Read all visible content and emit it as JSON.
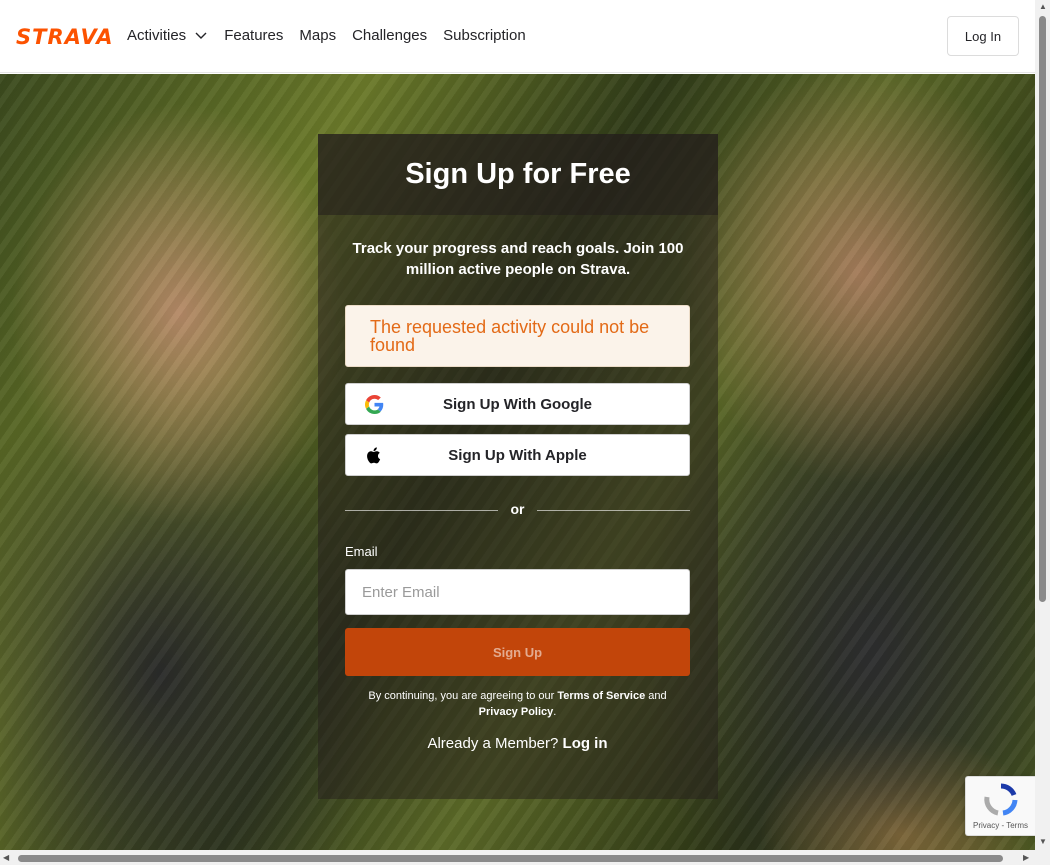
{
  "header": {
    "logo": "STRAVA",
    "nav": [
      {
        "label": "Activities",
        "has_dropdown": true
      },
      {
        "label": "Features"
      },
      {
        "label": "Maps"
      },
      {
        "label": "Challenges"
      },
      {
        "label": "Subscription"
      }
    ],
    "login_label": "Log In"
  },
  "card": {
    "title": "Sign Up for Free",
    "tagline": "Track your progress and reach goals. Join 100 million active people on Strava.",
    "alert": "The requested activity could not be found",
    "google_label": "Sign Up With Google",
    "apple_label": "Sign Up With Apple",
    "divider": "or",
    "email_label": "Email",
    "email_placeholder": "Enter Email",
    "email_value": "",
    "signup_label": "Sign Up",
    "legal_prefix": "By continuing, you are agreeing to our ",
    "terms_link": "Terms of Service",
    "legal_and": " and ",
    "privacy_link": "Privacy Policy",
    "legal_suffix": ".",
    "member_prefix": "Already a Member? ",
    "member_link": "Log in"
  },
  "recaptcha": {
    "links": "Privacy - Terms"
  },
  "colors": {
    "brand": "#fc5200",
    "signup_button": "#c2450a",
    "alert_text": "#e36a17",
    "alert_bg": "#fbf3ea"
  },
  "icons": [
    "chevron-down-icon",
    "google-icon",
    "apple-icon",
    "recaptcha-icon"
  ]
}
